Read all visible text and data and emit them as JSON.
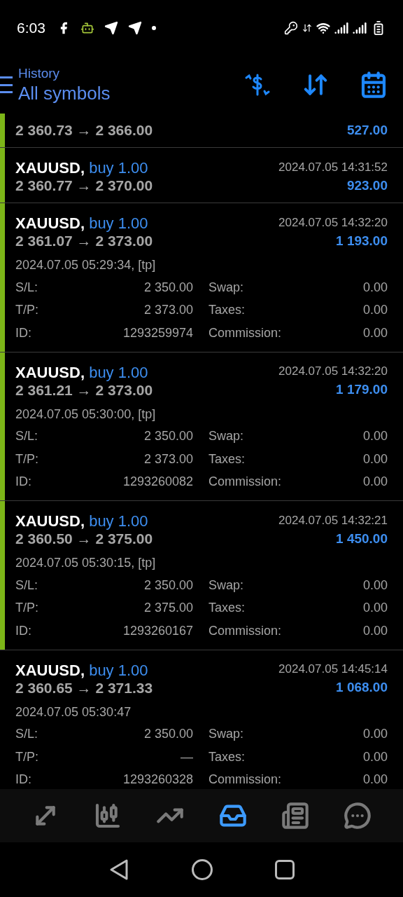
{
  "status_bar": {
    "time": "6:03"
  },
  "header": {
    "subtitle": "History",
    "title": "All symbols"
  },
  "trades": [
    {
      "marked": true,
      "prices": "2 360.73 → 2 366.00",
      "profit": "527.00"
    },
    {
      "marked": true,
      "symbol": "XAUUSD,",
      "side": "buy 1.00",
      "time": "2024.07.05 14:31:52",
      "prices": "2 360.77 → 2 370.00",
      "profit": "923.00"
    },
    {
      "marked": true,
      "symbol": "XAUUSD,",
      "side": "buy 1.00",
      "time": "2024.07.05 14:32:20",
      "prices": "2 361.07 → 2 373.00",
      "profit": "1 193.00",
      "comment": "2024.07.05 05:29:34, [tp]",
      "details": [
        [
          "S/L:",
          "2 350.00",
          "Swap:",
          "0.00"
        ],
        [
          "T/P:",
          "2 373.00",
          "Taxes:",
          "0.00"
        ],
        [
          "ID:",
          "1293259974",
          "Commission:",
          "0.00"
        ]
      ]
    },
    {
      "marked": true,
      "symbol": "XAUUSD,",
      "side": "buy 1.00",
      "time": "2024.07.05 14:32:20",
      "prices": "2 361.21 → 2 373.00",
      "profit": "1 179.00",
      "comment": "2024.07.05 05:30:00, [tp]",
      "details": [
        [
          "S/L:",
          "2 350.00",
          "Swap:",
          "0.00"
        ],
        [
          "T/P:",
          "2 373.00",
          "Taxes:",
          "0.00"
        ],
        [
          "ID:",
          "1293260082",
          "Commission:",
          "0.00"
        ]
      ]
    },
    {
      "marked": true,
      "symbol": "XAUUSD,",
      "side": "buy 1.00",
      "time": "2024.07.05 14:32:21",
      "prices": "2 360.50 → 2 375.00",
      "profit": "1 450.00",
      "comment": "2024.07.05 05:30:15, [tp]",
      "details": [
        [
          "S/L:",
          "2 350.00",
          "Swap:",
          "0.00"
        ],
        [
          "T/P:",
          "2 375.00",
          "Taxes:",
          "0.00"
        ],
        [
          "ID:",
          "1293260167",
          "Commission:",
          "0.00"
        ]
      ]
    },
    {
      "marked": false,
      "symbol": "XAUUSD,",
      "side": "buy 1.00",
      "time": "2024.07.05 14:45:14",
      "prices": "2 360.65 → 2 371.33",
      "profit": "1 068.00",
      "comment": "2024.07.05 05:30:47",
      "details": [
        [
          "S/L:",
          "2 350.00",
          "Swap:",
          "0.00"
        ],
        [
          "T/P:",
          "—",
          "Taxes:",
          "0.00"
        ],
        [
          "ID:",
          "1293260328",
          "Commission:",
          "0.00"
        ]
      ]
    }
  ],
  "bottom_nav": [
    {
      "kind": "trade",
      "selected": false
    },
    {
      "kind": "quotes",
      "selected": false
    },
    {
      "kind": "chart",
      "selected": false
    },
    {
      "kind": "history",
      "selected": true
    },
    {
      "kind": "news",
      "selected": false
    },
    {
      "kind": "chat",
      "selected": false
    }
  ]
}
